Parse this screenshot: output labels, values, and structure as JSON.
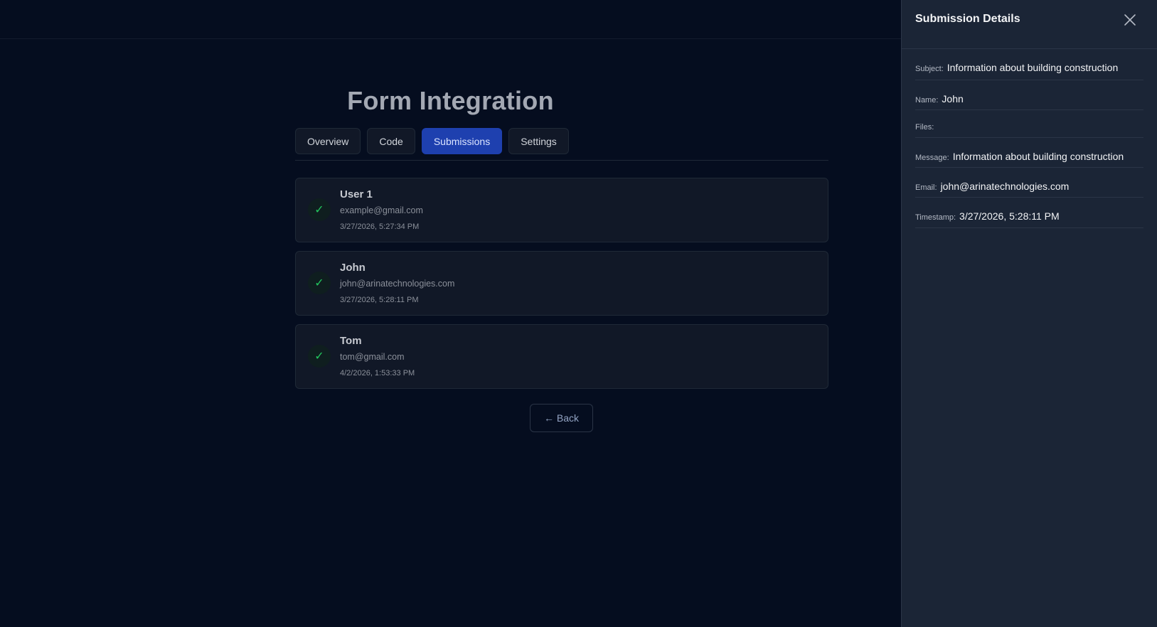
{
  "page": {
    "title": "Form Integration",
    "tabs": [
      {
        "label": "Overview",
        "active": false
      },
      {
        "label": "Code",
        "active": false
      },
      {
        "label": "Submissions",
        "active": true
      },
      {
        "label": "Settings",
        "active": false
      }
    ],
    "back_label": "← Back"
  },
  "submissions": [
    {
      "name": "User 1",
      "email": "example@gmail.com",
      "timestamp": "3/27/2026, 5:27:34 PM",
      "status_icon": "check-icon"
    },
    {
      "name": "John",
      "email": "john@arinatechnologies.com",
      "timestamp": "3/27/2026, 5:28:11 PM",
      "status_icon": "check-icon"
    },
    {
      "name": "Tom",
      "email": "tom@gmail.com",
      "timestamp": "4/2/2026, 1:53:33 PM",
      "status_icon": "check-icon"
    }
  ],
  "details": {
    "title": "Submission Details",
    "fields": [
      {
        "label": "Subject:",
        "value": "Information about building construction"
      },
      {
        "label": "Name:",
        "value": "John"
      },
      {
        "label": "Files:",
        "value": ""
      },
      {
        "label": "Message:",
        "value": "Information about building construction"
      },
      {
        "label": "Email:",
        "value": "john@arinatechnologies.com"
      },
      {
        "label": "Timestamp:",
        "value": "3/27/2026, 5:28:11 PM"
      }
    ]
  },
  "colors": {
    "background": "#050d1f",
    "accent": "#1e40af",
    "success": "#22c55e",
    "panel": "#1b2536"
  }
}
